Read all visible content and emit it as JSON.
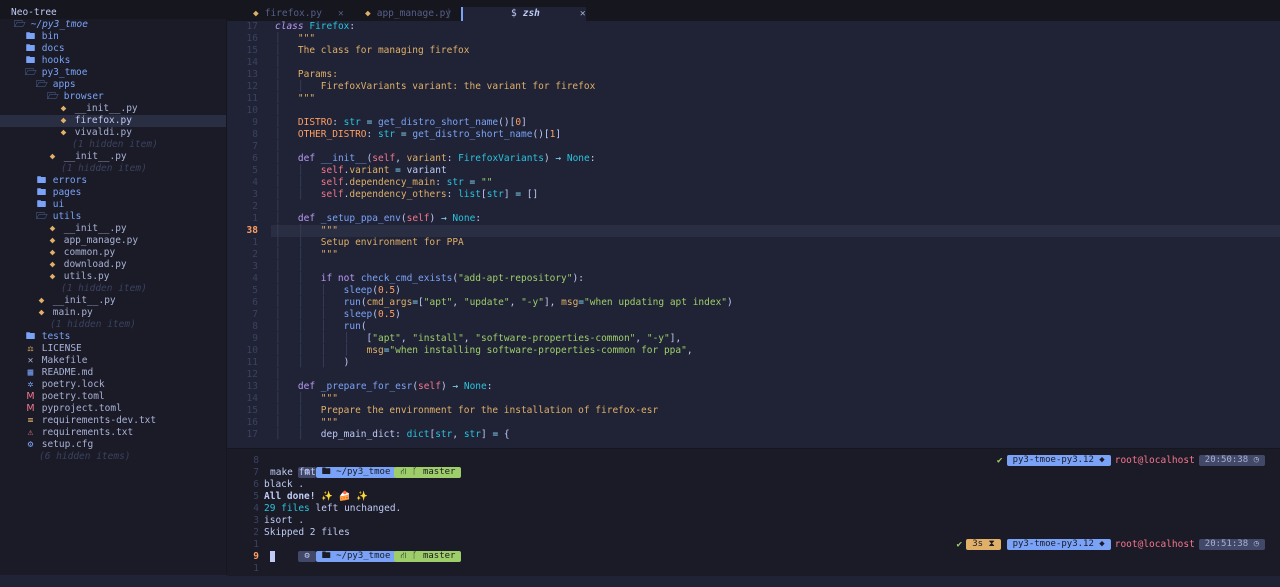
{
  "sidebar": {
    "title": "Neo-tree",
    "tree": [
      {
        "indent": 0,
        "type": "dir",
        "open": true,
        "label": "~/py3_tmoe",
        "root": true
      },
      {
        "indent": 1,
        "type": "dir",
        "open": false,
        "label": "bin"
      },
      {
        "indent": 1,
        "type": "dir",
        "open": false,
        "label": "docs"
      },
      {
        "indent": 1,
        "type": "dir",
        "open": false,
        "label": "hooks"
      },
      {
        "indent": 1,
        "type": "dir",
        "open": true,
        "label": "py3_tmoe"
      },
      {
        "indent": 2,
        "type": "dir",
        "open": true,
        "label": "apps"
      },
      {
        "indent": 3,
        "type": "dir",
        "open": true,
        "label": "browser"
      },
      {
        "indent": 4,
        "type": "file",
        "icon": "py",
        "label": "__init__.py"
      },
      {
        "indent": 4,
        "type": "file",
        "icon": "py",
        "label": "firefox.py",
        "selected": true
      },
      {
        "indent": 4,
        "type": "file",
        "icon": "py",
        "label": "vivaldi.py"
      },
      {
        "indent": 4,
        "type": "hidden",
        "label": "(1 hidden item)"
      },
      {
        "indent": 3,
        "type": "file",
        "icon": "py",
        "label": "__init__.py"
      },
      {
        "indent": 3,
        "type": "hidden",
        "label": "(1 hidden item)"
      },
      {
        "indent": 2,
        "type": "dir",
        "open": false,
        "label": "errors"
      },
      {
        "indent": 2,
        "type": "dir",
        "open": false,
        "label": "pages"
      },
      {
        "indent": 2,
        "type": "dir",
        "open": false,
        "label": "ui"
      },
      {
        "indent": 2,
        "type": "dir",
        "open": true,
        "label": "utils"
      },
      {
        "indent": 3,
        "type": "file",
        "icon": "py",
        "label": "__init__.py"
      },
      {
        "indent": 3,
        "type": "file",
        "icon": "py",
        "label": "app_manage.py"
      },
      {
        "indent": 3,
        "type": "file",
        "icon": "py",
        "label": "common.py"
      },
      {
        "indent": 3,
        "type": "file",
        "icon": "py",
        "label": "download.py"
      },
      {
        "indent": 3,
        "type": "file",
        "icon": "py",
        "label": "utils.py"
      },
      {
        "indent": 3,
        "type": "hidden",
        "label": "(1 hidden item)"
      },
      {
        "indent": 2,
        "type": "file",
        "icon": "py",
        "label": "__init__.py"
      },
      {
        "indent": 2,
        "type": "file",
        "icon": "py",
        "label": "main.py"
      },
      {
        "indent": 2,
        "type": "hidden",
        "label": "(1 hidden item)"
      },
      {
        "indent": 1,
        "type": "dir",
        "open": false,
        "label": "tests"
      },
      {
        "indent": 1,
        "type": "file",
        "icon": "lic",
        "label": "LICENSE"
      },
      {
        "indent": 1,
        "type": "file",
        "icon": "mk",
        "label": "Makefile"
      },
      {
        "indent": 1,
        "type": "file",
        "icon": "md",
        "label": "README.md"
      },
      {
        "indent": 1,
        "type": "file",
        "icon": "lock",
        "label": "poetry.lock"
      },
      {
        "indent": 1,
        "type": "file",
        "icon": "toml",
        "label": "poetry.toml"
      },
      {
        "indent": 1,
        "type": "file",
        "icon": "toml",
        "label": "pyproject.toml"
      },
      {
        "indent": 1,
        "type": "file",
        "icon": "txt",
        "label": "requirements-dev.txt"
      },
      {
        "indent": 1,
        "type": "file",
        "icon": "req",
        "label": "requirements.txt"
      },
      {
        "indent": 1,
        "type": "file",
        "icon": "cfg",
        "label": "setup.cfg"
      },
      {
        "indent": 1,
        "type": "hidden",
        "label": "(6 hidden items)"
      }
    ]
  },
  "tabs": [
    {
      "label": "firefox.py",
      "icon": "py"
    },
    {
      "label": "app_manage.py",
      "icon": "py"
    },
    {
      "label": "zsh",
      "icon": "$",
      "active": true
    }
  ],
  "editor": {
    "current_line": "38",
    "line_numbers": [
      "17",
      "16",
      "15",
      "14",
      "13",
      "12",
      "11",
      "10",
      "9",
      "8",
      "7",
      "6",
      "5",
      "4",
      "3",
      "2",
      "1",
      "38",
      "1",
      "2",
      "3",
      "4",
      "5",
      "6",
      "7",
      "8",
      "9",
      "10",
      "11",
      "12",
      "13",
      "14",
      "15",
      "16",
      "17"
    ]
  },
  "terminal": {
    "line_numbers": [
      "8",
      "7",
      "6",
      "5",
      "4",
      "3",
      "2",
      "1",
      "9",
      "1"
    ],
    "current_line": "9",
    "prompt": {
      "os": "⚙",
      "dir": "~/py3_tmoe",
      "git": "master",
      "venv": "py3-tmoe-py3.12",
      "host": "root@localhost"
    },
    "first_time": "20:50:38",
    "second_time": "20:51:38",
    "duration": "3s",
    "lines": {
      "cmd": "make fmt",
      "black": "black .",
      "done": "All done! ✨ 🍰 ✨",
      "files_count": "29 files",
      "files_rest": " left unchanged.",
      "isort": "isort .",
      "skipped": "Skipped 2 files"
    }
  }
}
